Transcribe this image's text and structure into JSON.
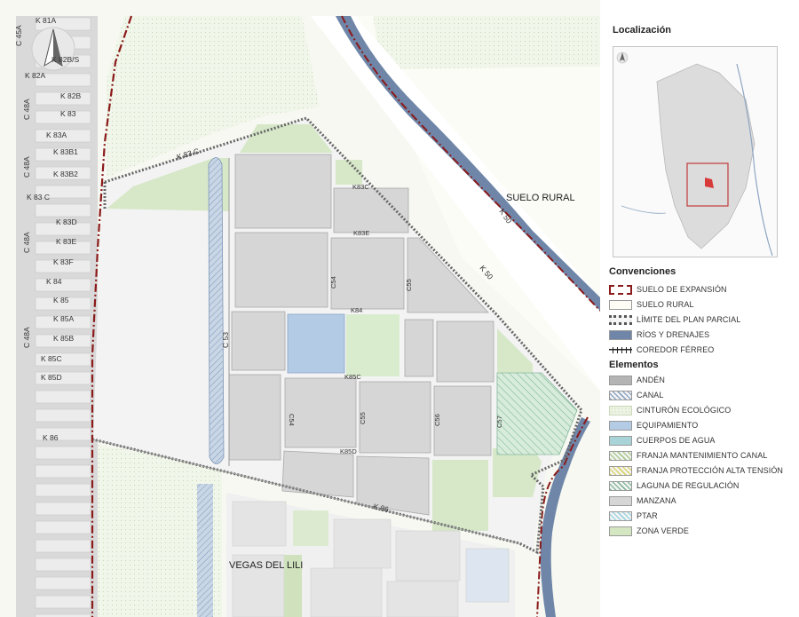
{
  "map": {
    "place_labels": {
      "suelo_rural": "SUELO RURAL",
      "vegas": "VEGAS DEL LILI"
    },
    "west_streets": [
      "K 81A",
      "C 45A",
      "K 82B/S",
      "K 82A",
      "K 82B",
      "C 48A",
      "K 83",
      "K 83A",
      "K 83B1",
      "C 48A",
      "K 83B2",
      "K 83 C",
      "K 83D",
      "K 83E",
      "C 48A",
      "K 83F",
      "K 84",
      "K 85",
      "K 85A",
      "C 48A",
      "K 85B",
      "K 85C",
      "K 85D",
      "K 86"
    ],
    "road_labels": {
      "k83c": "K 83 C",
      "k50a": "K 50",
      "k50b": "K 50",
      "k86": "K 86",
      "c53": "C 53"
    },
    "block_labels": {
      "k83c_in": "K83C",
      "k83e_in": "K83E",
      "c54a": "C54",
      "c55a": "C55",
      "k84_in": "K84",
      "k85c_in": "K85C",
      "c54b": "C54",
      "c55b": "C55",
      "c56": "C56",
      "k85d_in": "K85D",
      "c57": "C57"
    }
  },
  "panel": {
    "localizacion_title": "Localización",
    "convenciones_title": "Convenciones",
    "elementos_title": "Elementos",
    "convenciones": [
      {
        "label": "SUELO DE EXPANSIÓN",
        "style": "expansion",
        "color": "#8b1a1a"
      },
      {
        "label": "SUELO RURAL",
        "style": "fill",
        "color": "#fdfdf5"
      },
      {
        "label": "LÍMITE DEL PLAN PARCIAL",
        "style": "limit",
        "color": "#555555"
      },
      {
        "label": "RÍOS Y DRENAJES",
        "style": "fill",
        "color": "#6f86a8"
      },
      {
        "label": "COREDOR FÉRREO",
        "style": "rail",
        "color": "#222222"
      }
    ],
    "elementos": [
      {
        "label": "ANDÉN",
        "style": "fill",
        "color": "#b4b4b4"
      },
      {
        "label": "CANAL",
        "style": "hatch",
        "color": "#8fa6c4"
      },
      {
        "label": "CINTURÓN ECOLÓGICO",
        "style": "dots",
        "color": "#eef4e4"
      },
      {
        "label": "EQUIPAMIENTO",
        "style": "fill",
        "color": "#b3cbe4"
      },
      {
        "label": "CUERPOS DE AGUA",
        "style": "fill",
        "color": "#a8d4d8"
      },
      {
        "label": "FRANJA MANTENIMIENTO CANAL",
        "style": "hatch",
        "color": "#a9c98e"
      },
      {
        "label": "FRANJA PROTECCIÓN ALTA TENSIÓN",
        "style": "hatch",
        "color": "#d9d36a"
      },
      {
        "label": "LAGUNA DE REGULACIÓN",
        "style": "hatch",
        "color": "#86b89c"
      },
      {
        "label": "MANZANA",
        "style": "fill",
        "color": "#d6d6d6"
      },
      {
        "label": "PTAR",
        "style": "hatch",
        "color": "#9fd4e0"
      },
      {
        "label": "ZONA VERDE",
        "style": "fill",
        "color": "#d4e6c2"
      }
    ]
  }
}
